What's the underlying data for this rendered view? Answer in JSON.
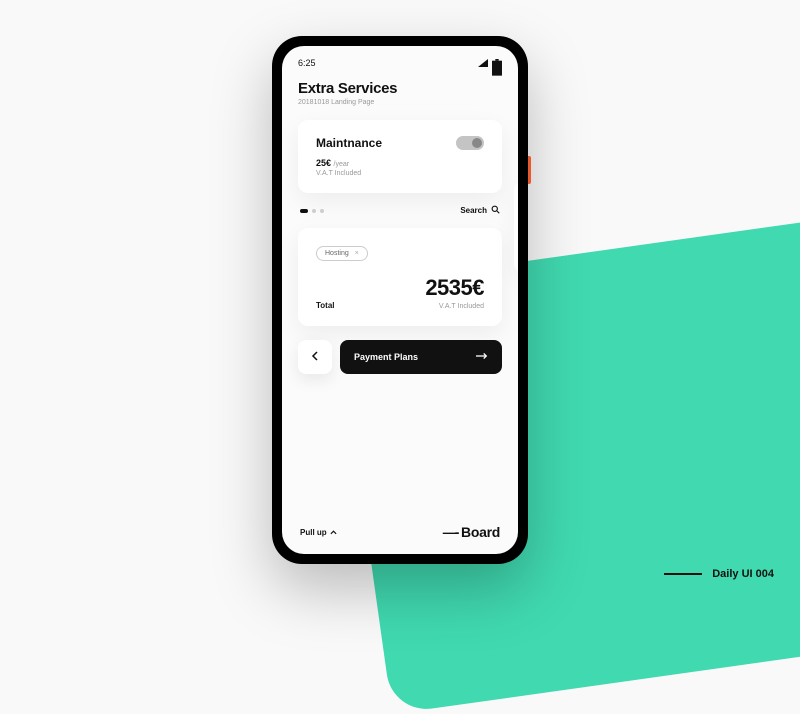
{
  "status": {
    "time": "6:25"
  },
  "header": {
    "title": "Extra Services",
    "subtitle": "20181018 Landing Page"
  },
  "service": {
    "name": "Maintnance",
    "price": "25€",
    "period": "/year",
    "vat": "V.A.T Included"
  },
  "search": {
    "label": "Search"
  },
  "chip": {
    "label": "Hosting"
  },
  "total": {
    "label": "Total",
    "amount": "2535€",
    "vat": "V.A.T Included"
  },
  "buttons": {
    "primary": "Payment Plans"
  },
  "footer": {
    "pullup": "Pull up",
    "brand": "Board"
  },
  "caption": "Daily UI 004"
}
